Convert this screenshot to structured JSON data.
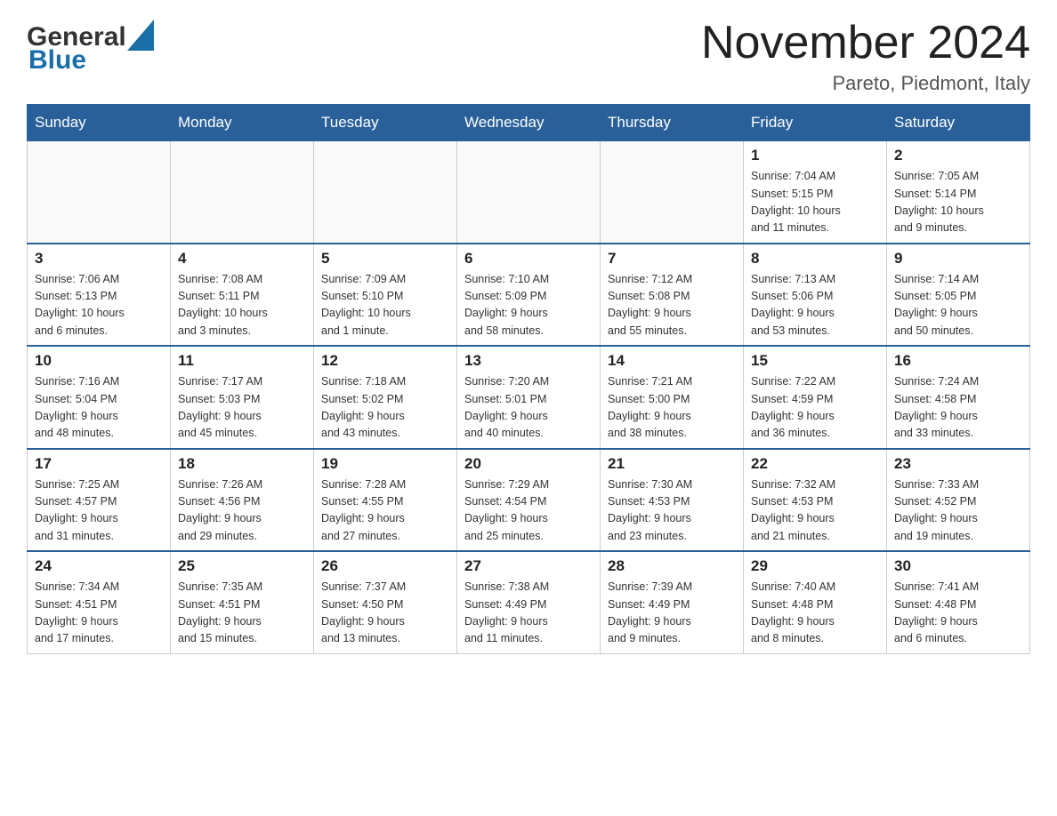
{
  "header": {
    "logo": {
      "general": "General",
      "blue": "Blue"
    },
    "title": "November 2024",
    "location": "Pareto, Piedmont, Italy"
  },
  "days_of_week": [
    "Sunday",
    "Monday",
    "Tuesday",
    "Wednesday",
    "Thursday",
    "Friday",
    "Saturday"
  ],
  "weeks": [
    {
      "days": [
        {
          "number": "",
          "info": ""
        },
        {
          "number": "",
          "info": ""
        },
        {
          "number": "",
          "info": ""
        },
        {
          "number": "",
          "info": ""
        },
        {
          "number": "",
          "info": ""
        },
        {
          "number": "1",
          "info": "Sunrise: 7:04 AM\nSunset: 5:15 PM\nDaylight: 10 hours\nand 11 minutes."
        },
        {
          "number": "2",
          "info": "Sunrise: 7:05 AM\nSunset: 5:14 PM\nDaylight: 10 hours\nand 9 minutes."
        }
      ]
    },
    {
      "days": [
        {
          "number": "3",
          "info": "Sunrise: 7:06 AM\nSunset: 5:13 PM\nDaylight: 10 hours\nand 6 minutes."
        },
        {
          "number": "4",
          "info": "Sunrise: 7:08 AM\nSunset: 5:11 PM\nDaylight: 10 hours\nand 3 minutes."
        },
        {
          "number": "5",
          "info": "Sunrise: 7:09 AM\nSunset: 5:10 PM\nDaylight: 10 hours\nand 1 minute."
        },
        {
          "number": "6",
          "info": "Sunrise: 7:10 AM\nSunset: 5:09 PM\nDaylight: 9 hours\nand 58 minutes."
        },
        {
          "number": "7",
          "info": "Sunrise: 7:12 AM\nSunset: 5:08 PM\nDaylight: 9 hours\nand 55 minutes."
        },
        {
          "number": "8",
          "info": "Sunrise: 7:13 AM\nSunset: 5:06 PM\nDaylight: 9 hours\nand 53 minutes."
        },
        {
          "number": "9",
          "info": "Sunrise: 7:14 AM\nSunset: 5:05 PM\nDaylight: 9 hours\nand 50 minutes."
        }
      ]
    },
    {
      "days": [
        {
          "number": "10",
          "info": "Sunrise: 7:16 AM\nSunset: 5:04 PM\nDaylight: 9 hours\nand 48 minutes."
        },
        {
          "number": "11",
          "info": "Sunrise: 7:17 AM\nSunset: 5:03 PM\nDaylight: 9 hours\nand 45 minutes."
        },
        {
          "number": "12",
          "info": "Sunrise: 7:18 AM\nSunset: 5:02 PM\nDaylight: 9 hours\nand 43 minutes."
        },
        {
          "number": "13",
          "info": "Sunrise: 7:20 AM\nSunset: 5:01 PM\nDaylight: 9 hours\nand 40 minutes."
        },
        {
          "number": "14",
          "info": "Sunrise: 7:21 AM\nSunset: 5:00 PM\nDaylight: 9 hours\nand 38 minutes."
        },
        {
          "number": "15",
          "info": "Sunrise: 7:22 AM\nSunset: 4:59 PM\nDaylight: 9 hours\nand 36 minutes."
        },
        {
          "number": "16",
          "info": "Sunrise: 7:24 AM\nSunset: 4:58 PM\nDaylight: 9 hours\nand 33 minutes."
        }
      ]
    },
    {
      "days": [
        {
          "number": "17",
          "info": "Sunrise: 7:25 AM\nSunset: 4:57 PM\nDaylight: 9 hours\nand 31 minutes."
        },
        {
          "number": "18",
          "info": "Sunrise: 7:26 AM\nSunset: 4:56 PM\nDaylight: 9 hours\nand 29 minutes."
        },
        {
          "number": "19",
          "info": "Sunrise: 7:28 AM\nSunset: 4:55 PM\nDaylight: 9 hours\nand 27 minutes."
        },
        {
          "number": "20",
          "info": "Sunrise: 7:29 AM\nSunset: 4:54 PM\nDaylight: 9 hours\nand 25 minutes."
        },
        {
          "number": "21",
          "info": "Sunrise: 7:30 AM\nSunset: 4:53 PM\nDaylight: 9 hours\nand 23 minutes."
        },
        {
          "number": "22",
          "info": "Sunrise: 7:32 AM\nSunset: 4:53 PM\nDaylight: 9 hours\nand 21 minutes."
        },
        {
          "number": "23",
          "info": "Sunrise: 7:33 AM\nSunset: 4:52 PM\nDaylight: 9 hours\nand 19 minutes."
        }
      ]
    },
    {
      "days": [
        {
          "number": "24",
          "info": "Sunrise: 7:34 AM\nSunset: 4:51 PM\nDaylight: 9 hours\nand 17 minutes."
        },
        {
          "number": "25",
          "info": "Sunrise: 7:35 AM\nSunset: 4:51 PM\nDaylight: 9 hours\nand 15 minutes."
        },
        {
          "number": "26",
          "info": "Sunrise: 7:37 AM\nSunset: 4:50 PM\nDaylight: 9 hours\nand 13 minutes."
        },
        {
          "number": "27",
          "info": "Sunrise: 7:38 AM\nSunset: 4:49 PM\nDaylight: 9 hours\nand 11 minutes."
        },
        {
          "number": "28",
          "info": "Sunrise: 7:39 AM\nSunset: 4:49 PM\nDaylight: 9 hours\nand 9 minutes."
        },
        {
          "number": "29",
          "info": "Sunrise: 7:40 AM\nSunset: 4:48 PM\nDaylight: 9 hours\nand 8 minutes."
        },
        {
          "number": "30",
          "info": "Sunrise: 7:41 AM\nSunset: 4:48 PM\nDaylight: 9 hours\nand 6 minutes."
        }
      ]
    }
  ]
}
